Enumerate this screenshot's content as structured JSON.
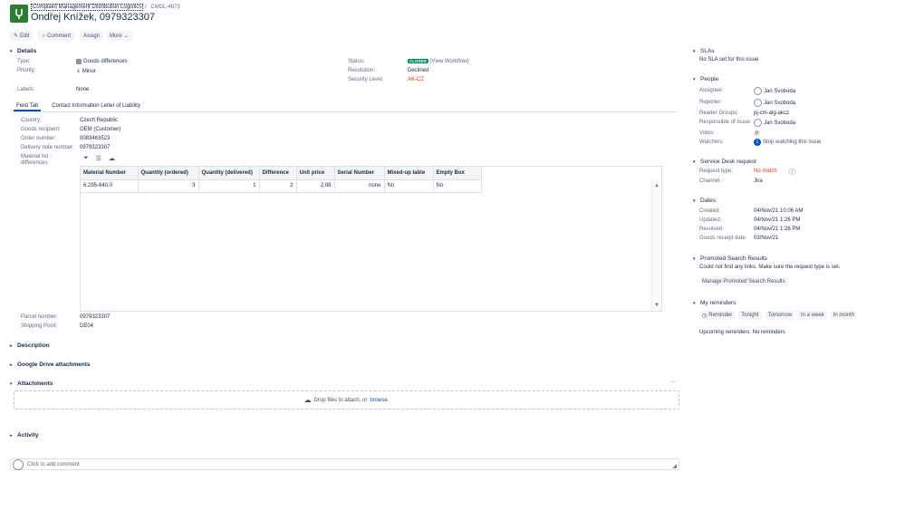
{
  "header": {
    "project": "Complaint Management Distribution Logistics",
    "separator": "/",
    "issue_key": "CMDL-4873",
    "title": "Ondřej Kníže​k, 0979323307"
  },
  "toolbar": {
    "edit": "Edit",
    "comment": "Comment",
    "assign": "Assign",
    "more": "More"
  },
  "details": {
    "heading": "Details",
    "type_label": "Type:",
    "type_value": "Goods differences",
    "priority_label": "Priority:",
    "priority_value": "Minor",
    "labels_label": "Labels:",
    "labels_value": "None",
    "status_label": "Status:",
    "status_value": "CLOSED",
    "view_workflow": "(View Workflow)",
    "resolution_label": "Resolution:",
    "resolution_value": "Declined",
    "security_label": "Security Level:",
    "security_value": "AK-CZ"
  },
  "tabs": [
    "Field Tab",
    "Contact Information Letter of Liability"
  ],
  "fields": {
    "country_label": "Country:",
    "country_value": "Czech Republic",
    "recipient_label": "Goods recipient:",
    "recipient_value": "OEM (Customer)",
    "order_label": "Order number:",
    "order_value": "0083463523",
    "delivery_label": "Delivery note number:",
    "delivery_value": "0979323307",
    "material_label": "Material list - differences:",
    "parcel_label": "Parcel number:",
    "parcel_value": "0979323307",
    "shipping_label": "Shipping Point:",
    "shipping_value": "DE04"
  },
  "material_table": {
    "headers": [
      "Material Number",
      "Quantity (ordered)",
      "Quantity (delivered)",
      "Difference",
      "Unit price",
      "Serial Number",
      "Mixed-up lable",
      "Empty Box"
    ],
    "rows": [
      [
        "6.295-840.0",
        "3",
        "1",
        "2",
        "2.08",
        "none",
        "No",
        "No"
      ]
    ]
  },
  "sections": {
    "description": "Description",
    "google_drive": "Google Drive attachments",
    "attachments": "Attachments",
    "drop_text": "Drop files to attach, or",
    "browse": "browse.",
    "activity": "Activity",
    "comment_placeholder": "Click to add comment",
    "more_dots": "···"
  },
  "sidebar": {
    "slas_heading": "SLAs",
    "slas_text": "No SLA set for this issue",
    "people_heading": "People",
    "assignee_label": "Assignee:",
    "assignee_value": "Jan Svoboda",
    "reporter_label": "Reporter:",
    "reporter_value": "Jan Svoboda",
    "reader_label": "Reader Groups:",
    "reader_value": "pj-cm-alg-akcz",
    "responsible_label": "Responsible of Issue:",
    "responsible_value": "Jan Svoboda",
    "votes_label": "Votes:",
    "votes_value": "0",
    "watchers_label": "Watchers:",
    "watchers_count": "1",
    "watchers_value": "Stop watching this issue",
    "sd_heading": "Service Desk request",
    "request_type_label": "Request type:",
    "request_type_value": "No match",
    "channel_label": "Channel:",
    "channel_value": "Jira",
    "dates_heading": "Dates",
    "created_label": "Created:",
    "created_value": "04/Nov/21 10:06 AM",
    "updated_label": "Updated:",
    "updated_value": "04/Nov/21 1:26 PM",
    "resolved_label": "Resolved:",
    "resolved_value": "04/Nov/21 1:26 PM",
    "receipt_label": "Goods receipt date:",
    "receipt_value": "03/Nov/21",
    "promoted_heading": "Promoted Search Results",
    "promoted_text": "Could not find any links. Make sure the request type is set.",
    "promoted_button": "Manage Promoted Search Results",
    "reminders_heading": "My reminders",
    "reminder_buttons": [
      "Reminder",
      "Tonight",
      "Tomorrow",
      "In a week",
      "In month"
    ],
    "upcoming_text": "Upcoming reminders: No reminders"
  }
}
